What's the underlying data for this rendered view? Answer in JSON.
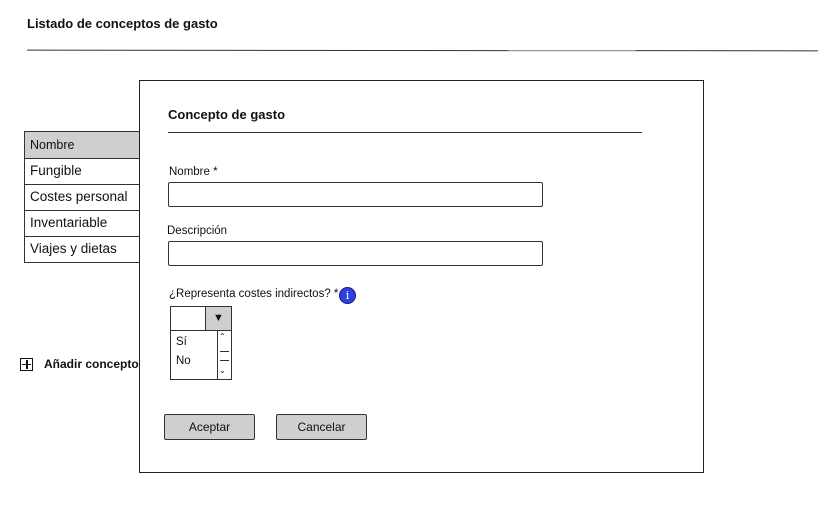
{
  "page": {
    "title": "Listado de conceptos de gasto",
    "add_label": "Añadir concepto d"
  },
  "table": {
    "header": "Nombre",
    "rows": [
      "Fungible",
      "Costes personal",
      "Inventariable",
      "Viajes y dietas"
    ]
  },
  "modal": {
    "title": "Concepto de gasto",
    "nombre_label": "Nombre *",
    "nombre_value": "",
    "descripcion_label": "Descripción",
    "descripcion_value": "",
    "indirect_label": "¿Representa costes indirectos? *",
    "info_glyph": "i",
    "select_value": "",
    "arrow_glyph": "▼",
    "options": [
      "Sí",
      "No"
    ],
    "accept_label": "Aceptar",
    "cancel_label": "Cancelar"
  },
  "colors": {
    "info": "#2f3fe0",
    "header_bg": "#cfcfcf",
    "button_bg": "#cfcfcf"
  }
}
